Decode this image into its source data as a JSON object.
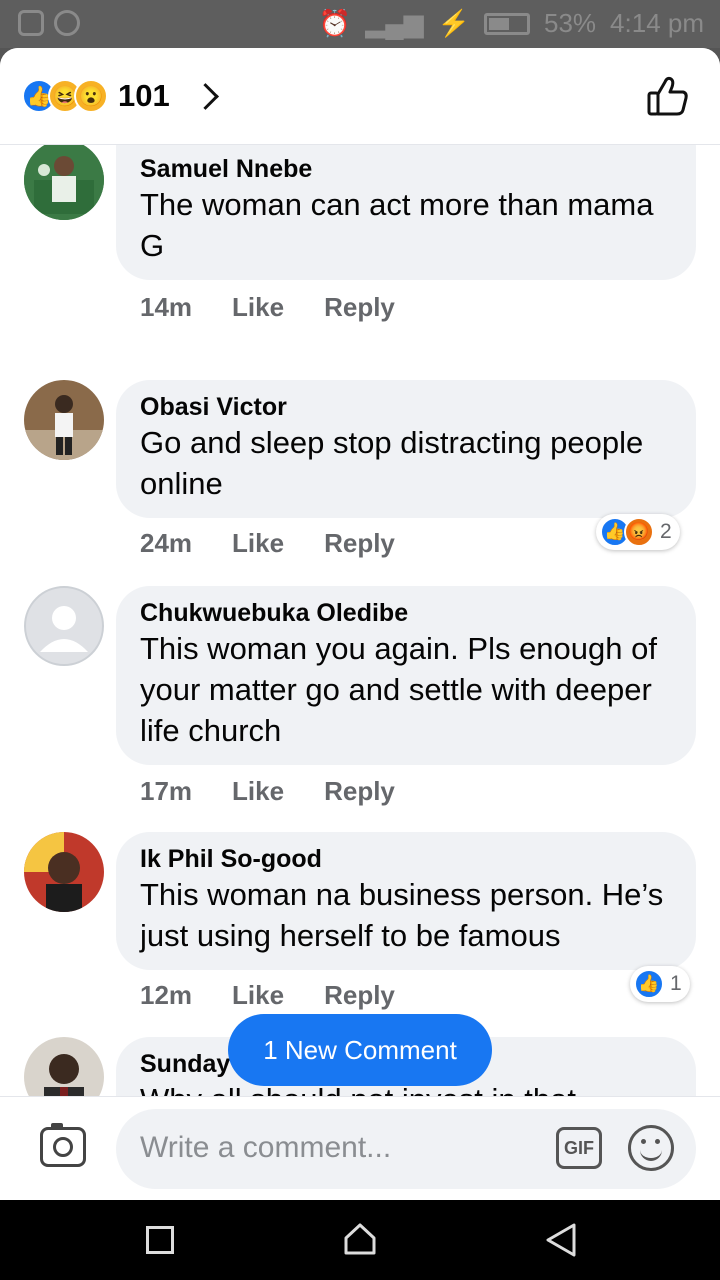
{
  "status_bar": {
    "battery": "53%",
    "time": "4:14 pm"
  },
  "header": {
    "reaction_count": "101"
  },
  "comments": [
    {
      "name": "Samuel Nnebe",
      "text": "The woman can act more than mama G",
      "time": "14m",
      "like": "Like",
      "reply": "Reply"
    },
    {
      "name": "Obasi Victor",
      "text": "Go and sleep stop distracting people online",
      "time": "24m",
      "like": "Like",
      "reply": "Reply",
      "reaction_count": "2"
    },
    {
      "name": "Chukwuebuka Oledibe",
      "text": "This woman you again. Pls enough of your matter go and settle with deeper life church",
      "time": "17m",
      "like": "Like",
      "reply": "Reply"
    },
    {
      "name": "Ik Phil So-good",
      "text": "This woman na business person. He’s just using herself to be famous",
      "time": "12m",
      "like": "Like",
      "reply": "Reply",
      "reaction_count": "1"
    },
    {
      "name": "Sunday Amos",
      "text": "Why all should not invest in that company that made",
      "partial": true
    }
  ],
  "new_comment_pill": "1 New Comment",
  "composer": {
    "placeholder": "Write a comment...",
    "gif_label": "GIF"
  },
  "colors": {
    "facebook_blue": "#1877f2",
    "bubble_bg": "#f0f2f5",
    "meta_gray": "#65676b"
  }
}
